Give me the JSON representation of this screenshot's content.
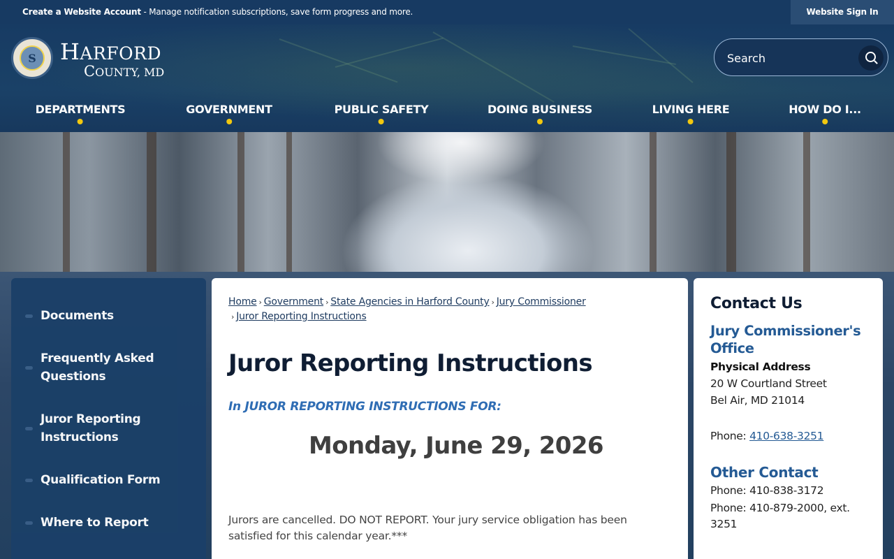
{
  "topbar": {
    "create_account": "Create a Website Account",
    "message": " - Manage notification subscriptions, save form progress and more.",
    "signin": "Website Sign In"
  },
  "brand": {
    "seal_letter": "S",
    "name_first": "H",
    "name_rest": "ARFORD",
    "county_first": "C",
    "county_rest": "OUNTY, MD"
  },
  "search": {
    "placeholder": "Search",
    "icon": "search-icon"
  },
  "nav": {
    "items": [
      {
        "label": "DEPARTMENTS"
      },
      {
        "label": "GOVERNMENT"
      },
      {
        "label": "PUBLIC SAFETY"
      },
      {
        "label": "DOING BUSINESS"
      },
      {
        "label": "LIVING HERE"
      },
      {
        "label": "HOW DO I..."
      }
    ]
  },
  "sidebar": {
    "items": [
      {
        "label": "Documents"
      },
      {
        "label": "Frequently Asked Questions"
      },
      {
        "label": "Juror Reporting Instructions"
      },
      {
        "label": "Qualification Form"
      },
      {
        "label": "Where to Report"
      }
    ]
  },
  "breadcrumb": {
    "items": [
      {
        "label": "Home"
      },
      {
        "label": "Government"
      },
      {
        "label": "State Agencies in Harford County"
      },
      {
        "label": "Jury Commissioner"
      },
      {
        "label": "Juror Reporting Instructions"
      }
    ],
    "separator": "›"
  },
  "main": {
    "title": "Juror Reporting Instructions",
    "subhead": "In JUROR REPORTING INSTRUCTIONS FOR:",
    "date": "Monday, June 29, 2026",
    "body": "Jurors are cancelled. DO NOT REPORT. Your jury service obligation has been satisfied for this calendar year.***"
  },
  "contact": {
    "title": "Contact Us",
    "office": "Jury Commissioner's Office",
    "address_label": "Physical Address",
    "address_line1": "20 W Courtland Street",
    "address_line2": "Bel Air, MD 21014",
    "phone_label": "Phone: ",
    "phone": "410-638-3251",
    "other_title": "Other Contact",
    "other_phone1": "Phone: 410-838-3172",
    "other_phone2": "Phone: 410-879-2000, ext. 3251"
  },
  "colors": {
    "header_bg": "#173a62",
    "accent_dot": "#f2c80f",
    "link": "#245a94",
    "subhead": "#2f6db4"
  }
}
